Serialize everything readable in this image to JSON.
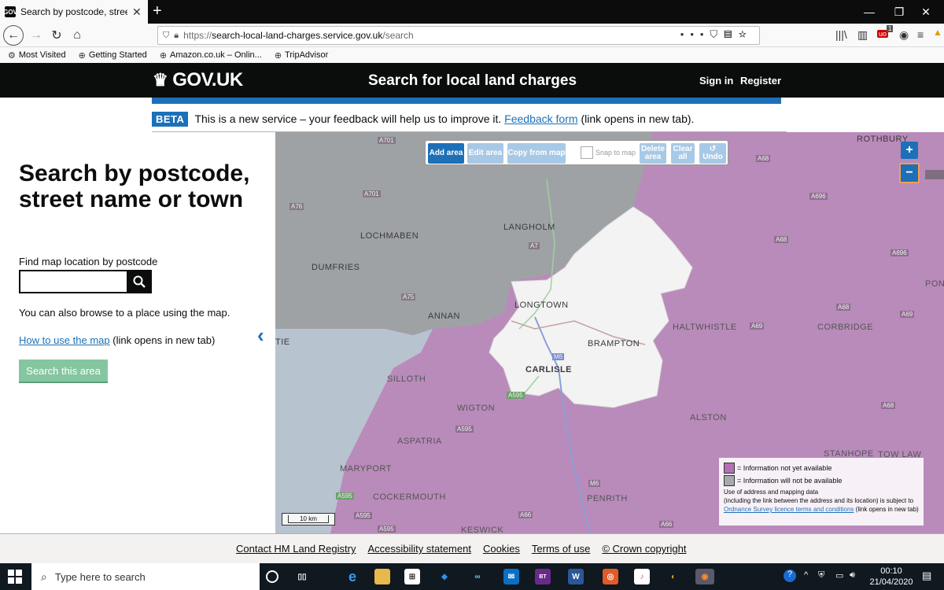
{
  "browser": {
    "tab_title": "Search by postcode, street nam",
    "url_protocol": "https://",
    "url_host": "search-local-land-charges.service.gov.uk",
    "url_path": "/search",
    "bookmarks": [
      {
        "label": "Most Visited"
      },
      {
        "label": "Getting Started"
      },
      {
        "label": "Amazon.co.uk – Onlin..."
      },
      {
        "label": "TripAdvisor"
      }
    ],
    "badge_count": "1"
  },
  "header": {
    "logo_text": "GOV.UK",
    "service_name": "Search for local land charges",
    "sign_in": "Sign in",
    "register": "Register"
  },
  "beta": {
    "tag": "BETA",
    "text": "This is a new service – your feedback will help us to improve it.",
    "link": "Feedback form",
    "suffix": "(link opens in new tab)."
  },
  "search_panel": {
    "title": "Search by postcode, street name or town",
    "label": "Find map location by postcode",
    "input_value": "",
    "browse_text": "You can also browse to a place using the map.",
    "howto_link": "How to use the map",
    "howto_suffix": "(link opens in new tab)",
    "search_area_button": "Search this area"
  },
  "map": {
    "tools": {
      "add_area": "Add area",
      "edit_area": "Edit area",
      "copy_from_map": "Copy from map",
      "snap_to_map": "Snap to map",
      "delete_area": "Delete area",
      "clear_all": "Clear all",
      "undo": "Undo"
    },
    "zoom_in": "+",
    "zoom_out": "−",
    "scale_label": "10 km",
    "places": {
      "rothbury": "ROTHBURY",
      "langholm": "LANGHOLM",
      "lochmaben": "LOCHMABEN",
      "dumfries": "DUMFRIES",
      "annan": "ANNAN",
      "longtown": "LONGTOWN",
      "brampton": "BRAMPTON",
      "carlisle": "CARLISLE",
      "haltwhistle": "HALTWHISTLE",
      "corbridge": "CORBRIDGE",
      "ponte": "PONTE",
      "silloth": "SILLOTH",
      "wigton": "WIGTON",
      "aspatria": "ASPATRIA",
      "alston": "ALSTON",
      "stanhope": "STANHOPE",
      "tow_law": "TOW LAW",
      "maryport": "MARYPORT",
      "cockermouth": "COCKERMOUTH",
      "penrith": "PENRITH",
      "keswick": "KESWICK",
      "tie": "TIE"
    },
    "roads": {
      "a701_top": "A701",
      "a701": "A701",
      "a76": "A76",
      "a7": "A7",
      "a75": "A75",
      "a68_top": "A68",
      "a696_1": "A696",
      "a68_mid": "A68",
      "a696_2": "A696",
      "a68_low": "A68",
      "a69_1": "A69",
      "a69_2": "A69",
      "m6_1": "M6",
      "a595_1": "A595",
      "a595_2": "A595",
      "a595_3": "A595",
      "m6_2": "M6",
      "a66_1": "A66",
      "a66_2": "A66",
      "a68_br": "A68",
      "a595_4": "A595",
      "a595_5": "A595"
    },
    "legend": {
      "not_yet": "= Information not yet available",
      "not_available": "= Information will not be available",
      "note1": "Use of address and mapping data",
      "note2": "(including the link between the address and its location) is subject to",
      "note_link": "Ordnance Survey licence terms and conditions",
      "note_suffix": "(link opens in new tab)"
    },
    "colors": {
      "not_yet": "#b56fb6",
      "not_available": "#a7a9ac",
      "available": "#f2f2f2",
      "sea": "#b8c4d0"
    }
  },
  "footer": {
    "links": [
      "Contact HM Land Registry",
      "Accessibility statement",
      "Cookies",
      "Terms of use",
      "© Crown copyright"
    ]
  },
  "taskbar": {
    "search_placeholder": "Type here to search",
    "time": "00:10",
    "date": "21/04/2020"
  }
}
